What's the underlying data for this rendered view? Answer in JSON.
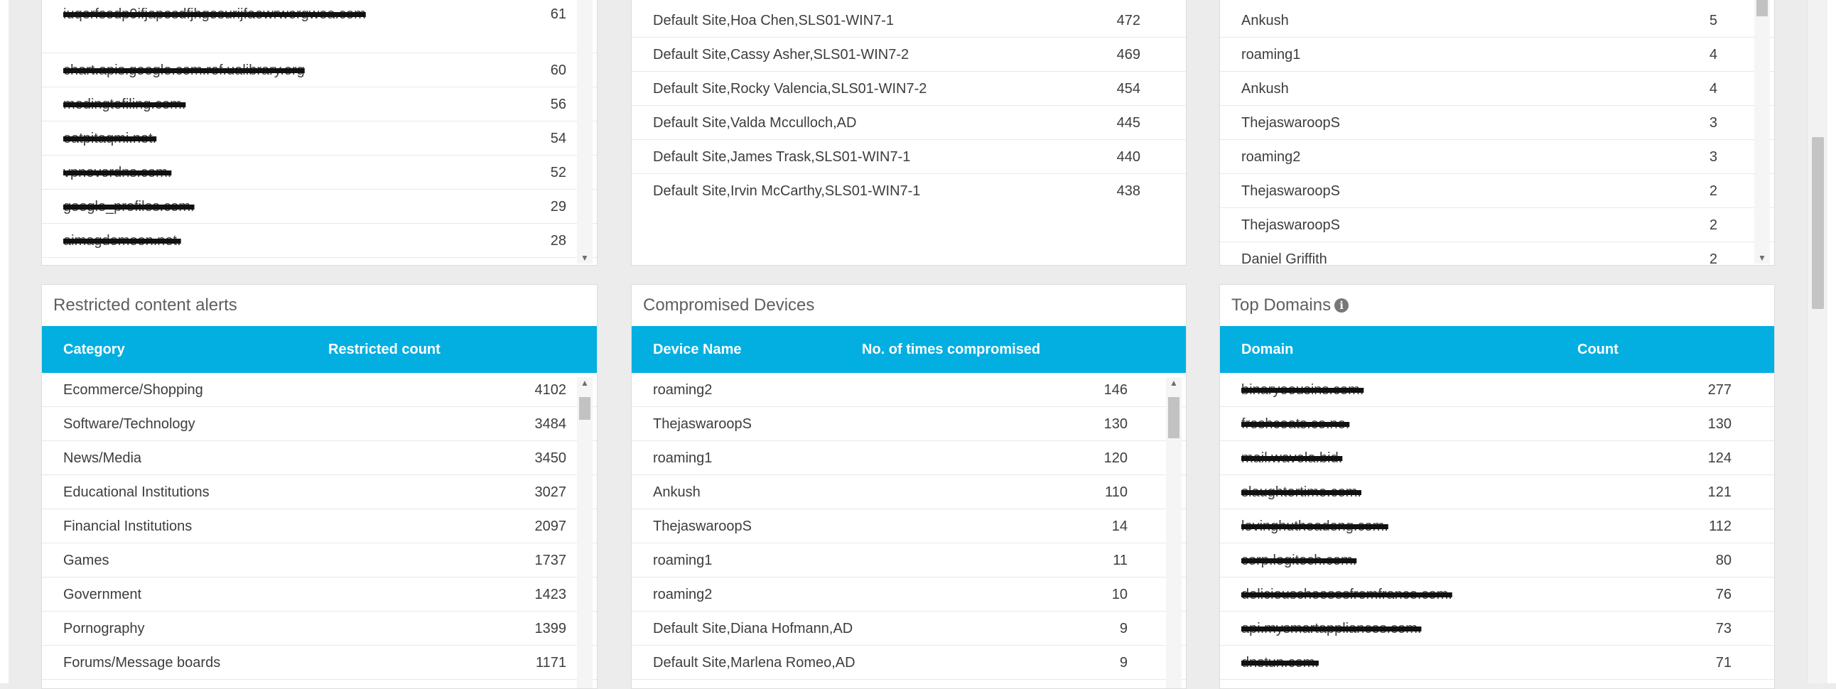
{
  "top_urls": {
    "rows": [
      {
        "name": "iuqerfsodp9ifjaposdfjhgosurijfaewrwergwea.com",
        "count": "61"
      },
      {
        "name": "chart.apis.google.com.ref.ualibrary.org",
        "count": "60"
      },
      {
        "name": "medingtefiling.com.",
        "count": "56"
      },
      {
        "name": "eatpitaqmi.net.",
        "count": "54"
      },
      {
        "name": "vpnevordns.com.",
        "count": "52"
      },
      {
        "name": "google_profiles.com.",
        "count": "29"
      },
      {
        "name": "aimagdomoon.net.",
        "count": "28"
      }
    ]
  },
  "top_identities": {
    "rows": [
      {
        "name": "Default Site,Hoa Chen,SLS01-WIN7-1",
        "count": "472"
      },
      {
        "name": "Default Site,Cassy Asher,SLS01-WIN7-2",
        "count": "469"
      },
      {
        "name": "Default Site,Rocky Valencia,SLS01-WIN7-2",
        "count": "454"
      },
      {
        "name": "Default Site,Valda Mcculloch,AD",
        "count": "445"
      },
      {
        "name": "Default Site,James Trask,SLS01-WIN7-1",
        "count": "440"
      },
      {
        "name": "Default Site,Irvin McCarthy,SLS01-WIN7-1",
        "count": "438"
      }
    ]
  },
  "top_users": {
    "rows": [
      {
        "name": "Ankush",
        "count": "5"
      },
      {
        "name": "roaming1",
        "count": "4"
      },
      {
        "name": "Ankush",
        "count": "4"
      },
      {
        "name": "ThejaswaroopS",
        "count": "3"
      },
      {
        "name": "roaming2",
        "count": "3"
      },
      {
        "name": "ThejaswaroopS",
        "count": "2"
      },
      {
        "name": "ThejaswaroopS",
        "count": "2"
      },
      {
        "name": "Daniel Griffith",
        "count": "2"
      }
    ]
  },
  "restricted": {
    "title": "Restricted content alerts",
    "col1": "Category",
    "col2": "Restricted count",
    "rows": [
      {
        "name": "Ecommerce/Shopping",
        "count": "4102"
      },
      {
        "name": "Software/Technology",
        "count": "3484"
      },
      {
        "name": "News/Media",
        "count": "3450"
      },
      {
        "name": "Educational Institutions",
        "count": "3027"
      },
      {
        "name": "Financial Institutions",
        "count": "2097"
      },
      {
        "name": "Games",
        "count": "1737"
      },
      {
        "name": "Government",
        "count": "1423"
      },
      {
        "name": "Pornography",
        "count": "1399"
      },
      {
        "name": "Forums/Message boards",
        "count": "1171"
      }
    ]
  },
  "compromised": {
    "title": "Compromised Devices",
    "col1": "Device Name",
    "col2": "No. of times compromised",
    "rows": [
      {
        "name": "roaming2",
        "count": "146"
      },
      {
        "name": "ThejaswaroopS",
        "count": "130"
      },
      {
        "name": "roaming1",
        "count": "120"
      },
      {
        "name": "Ankush",
        "count": "110"
      },
      {
        "name": "ThejaswaroopS",
        "count": "14"
      },
      {
        "name": "roaming1",
        "count": "11"
      },
      {
        "name": "roaming2",
        "count": "10"
      },
      {
        "name": "Default Site,Diana Hofmann,AD",
        "count": "9"
      },
      {
        "name": "Default Site,Marlena Romeo,AD",
        "count": "9"
      }
    ]
  },
  "top_domains": {
    "title": "Top Domains",
    "col1": "Domain",
    "col2": "Count",
    "rows": [
      {
        "name": "binaryoousins.com.",
        "count": "277"
      },
      {
        "name": "freshcoats.co.ne.",
        "count": "130"
      },
      {
        "name": "mail.wavela.bid.",
        "count": "124"
      },
      {
        "name": "slaughtertime.com.",
        "count": "121"
      },
      {
        "name": "lovinghutheadeng.com.",
        "count": "112"
      },
      {
        "name": "corp.logitech.com.",
        "count": "80"
      },
      {
        "name": "deliciouscheesesfromfrance.com.",
        "count": "76"
      },
      {
        "name": "api.mysmartappliances.com.",
        "count": "73"
      },
      {
        "name": "dnstun.com.",
        "count": "71"
      }
    ]
  },
  "colors": {
    "header": "#03afe1",
    "text": "#3d3d3d",
    "redaction": "#111111"
  },
  "icons": {
    "scroll_up": "▲",
    "scroll_down": "▼",
    "info": "i"
  }
}
